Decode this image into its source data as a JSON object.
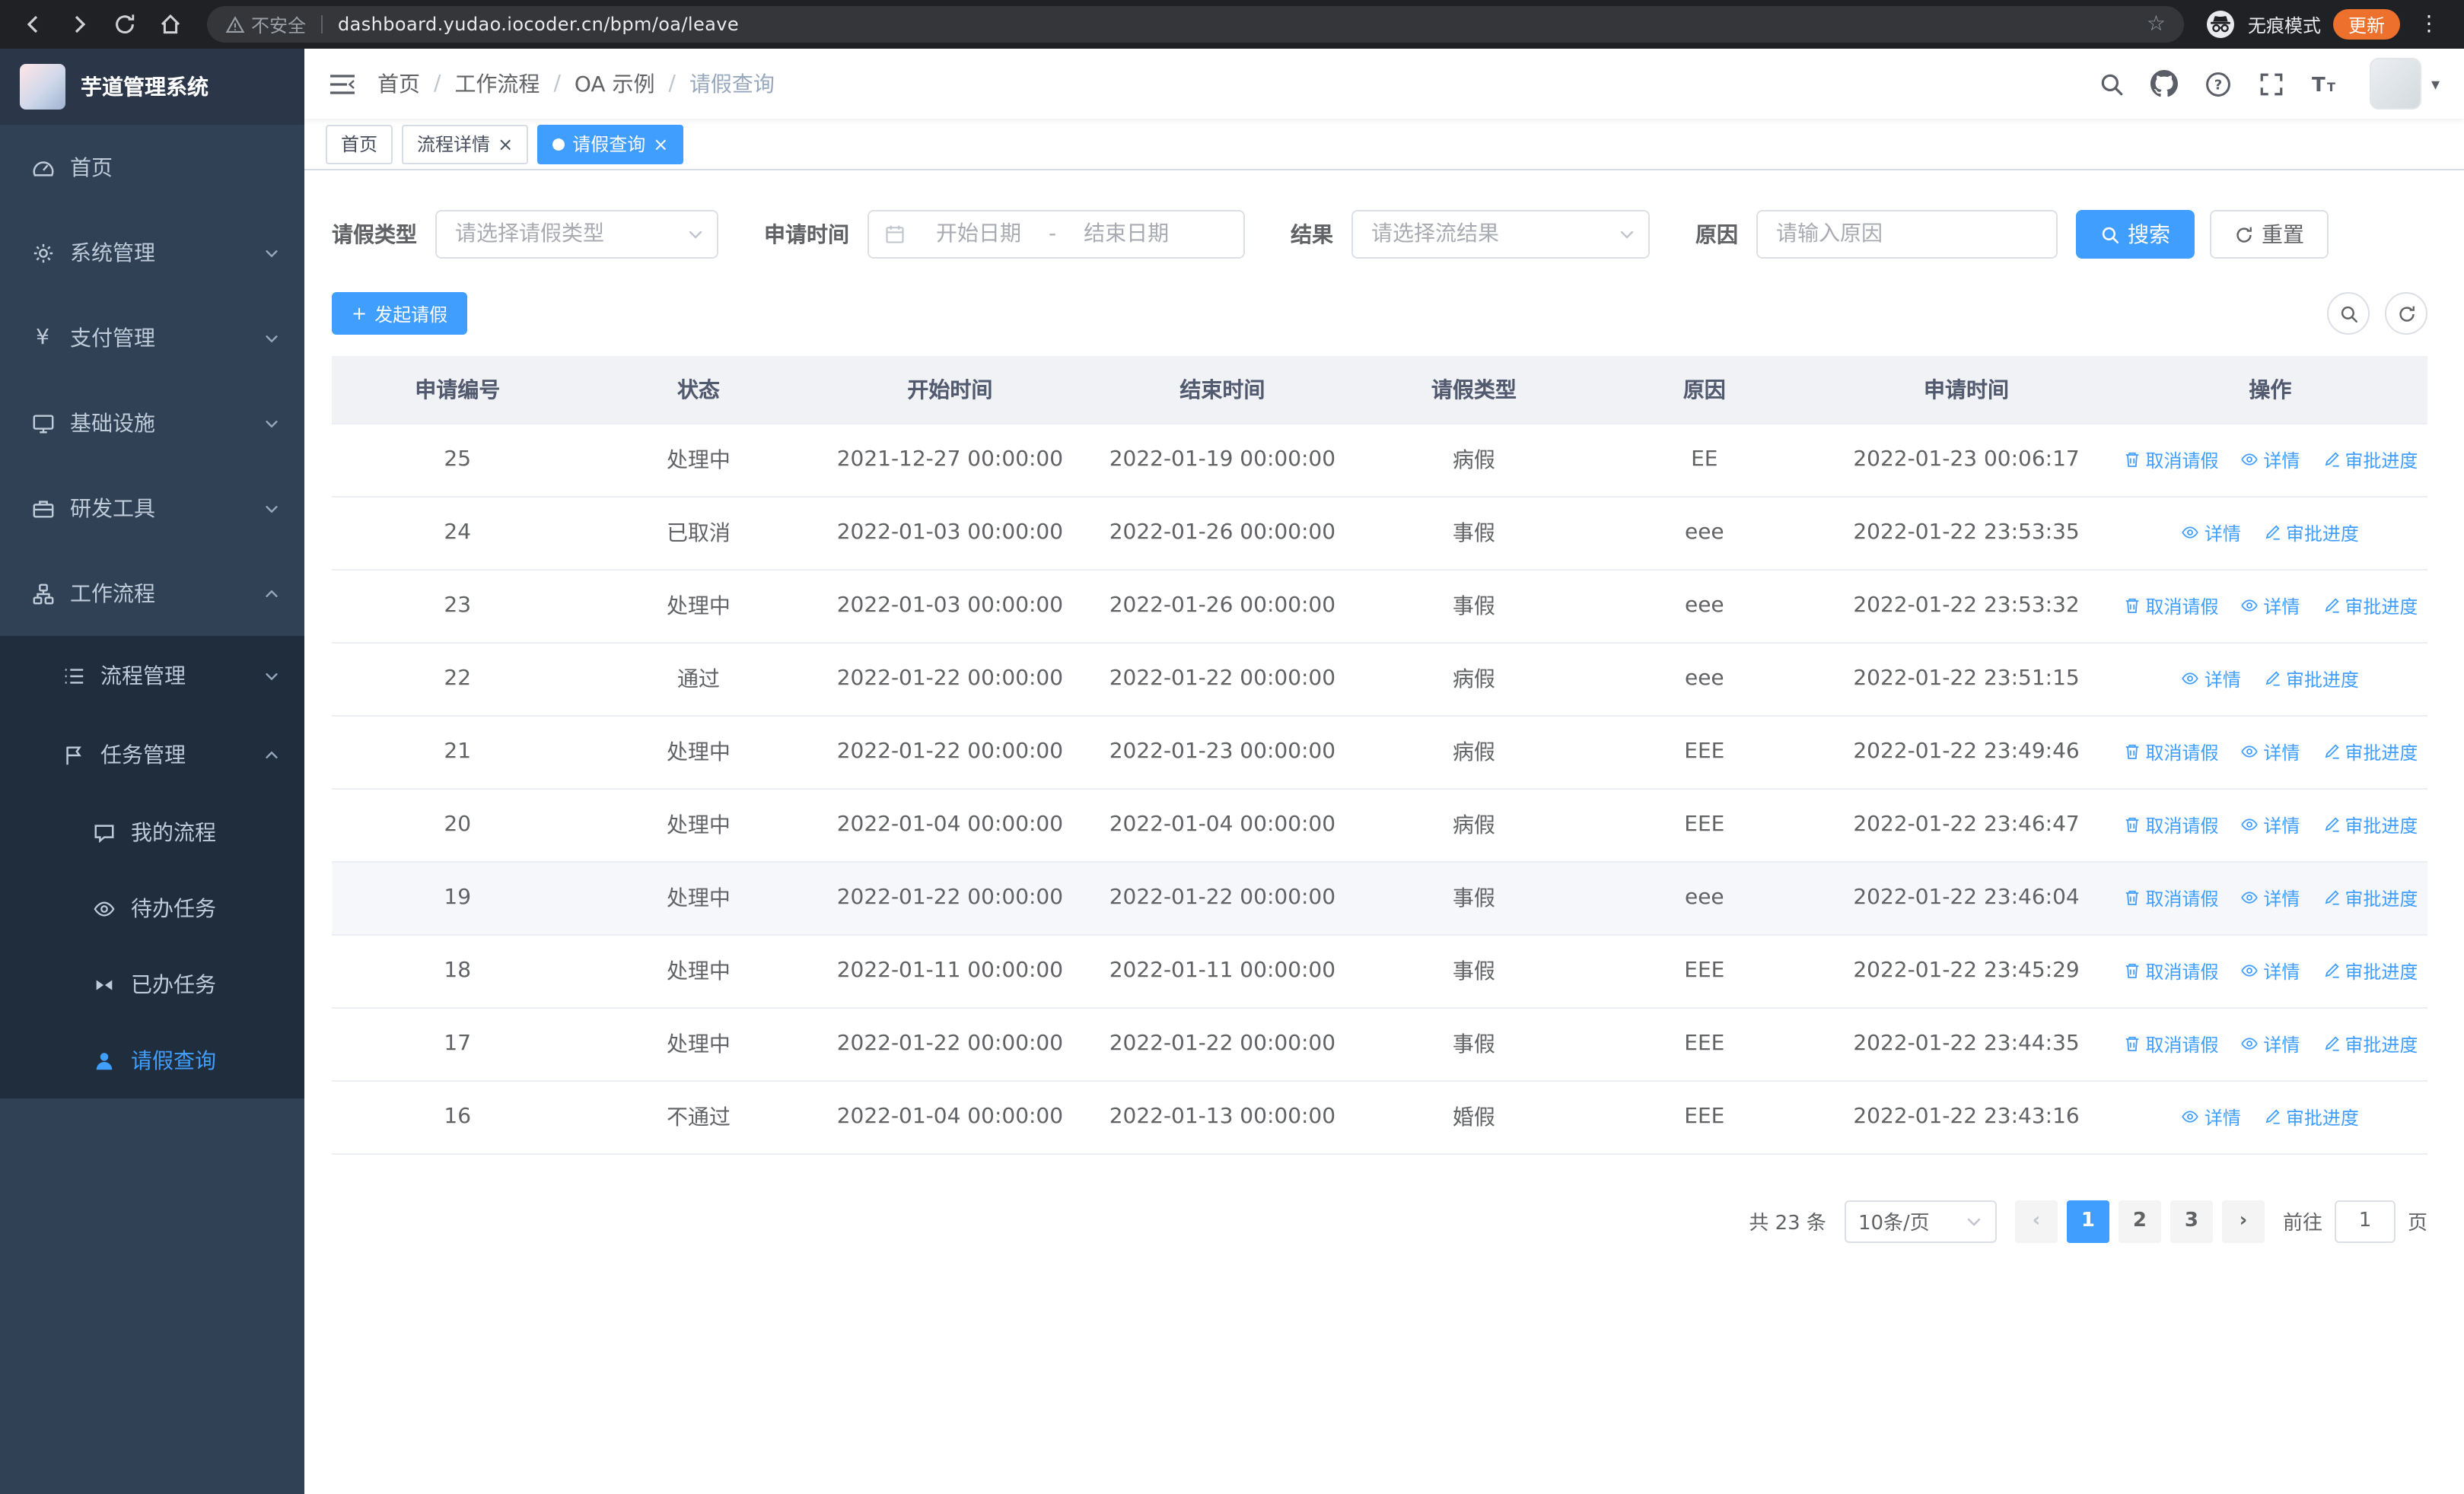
{
  "browser": {
    "security_warning": "不安全",
    "url": "dashboard.yudao.iocoder.cn/bpm/oa/leave",
    "incognito_label": "无痕模式",
    "update_label": "更新"
  },
  "icons": {
    "star": "☆",
    "kebab": "⋮",
    "close": "×",
    "plus": "+",
    "caret_down": "▾",
    "prev": "‹",
    "next": "›",
    "money": "¥"
  },
  "sidebar": {
    "logo_title": "芋道管理系统",
    "menu": [
      {
        "label": "首页"
      },
      {
        "label": "系统管理",
        "expandable": true
      },
      {
        "label": "支付管理",
        "expandable": true
      },
      {
        "label": "基础设施",
        "expandable": true
      },
      {
        "label": "研发工具",
        "expandable": true
      },
      {
        "label": "工作流程",
        "expandable": true,
        "expanded": true
      }
    ],
    "process_submenu": [
      {
        "label": "流程管理",
        "expandable": true
      },
      {
        "label": "任务管理",
        "expandable": true,
        "expanded": true
      }
    ],
    "task_children": [
      {
        "label": "我的流程"
      },
      {
        "label": "待办任务"
      },
      {
        "label": "已办任务"
      },
      {
        "label": "请假查询",
        "active": true
      }
    ]
  },
  "header": {
    "breadcrumb": [
      "首页",
      "工作流程",
      "OA 示例",
      "请假查询"
    ],
    "separator": "/"
  },
  "tabs": [
    {
      "label": "首页",
      "closable": false,
      "active": false
    },
    {
      "label": "流程详情",
      "closable": true,
      "active": false
    },
    {
      "label": "请假查询",
      "closable": true,
      "active": true
    }
  ],
  "filters": {
    "leave_type_label": "请假类型",
    "leave_type_placeholder": "请选择请假类型",
    "apply_time_label": "申请时间",
    "start_date_placeholder": "开始日期",
    "range_separator": "-",
    "end_date_placeholder": "结束日期",
    "result_label": "结果",
    "result_placeholder": "请选择流结果",
    "reason_label": "原因",
    "reason_placeholder": "请输入原因",
    "search_label": "搜索",
    "reset_label": "重置"
  },
  "toolbar": {
    "create_label": "发起请假"
  },
  "table": {
    "columns": [
      "申请编号",
      "状态",
      "开始时间",
      "结束时间",
      "请假类型",
      "原因",
      "申请时间",
      "操作"
    ],
    "actions": {
      "cancel": "取消请假",
      "detail": "详情",
      "progress": "审批进度"
    },
    "rows": [
      {
        "no": "25",
        "status": "处理中",
        "start": "2021-12-27 00:00:00",
        "end": "2022-01-19 00:00:00",
        "type": "病假",
        "reason": "EE",
        "applied": "2022-01-23 00:06:17",
        "can_cancel": true,
        "highlight": false
      },
      {
        "no": "24",
        "status": "已取消",
        "start": "2022-01-03 00:00:00",
        "end": "2022-01-26 00:00:00",
        "type": "事假",
        "reason": "eee",
        "applied": "2022-01-22 23:53:35",
        "can_cancel": false,
        "highlight": false
      },
      {
        "no": "23",
        "status": "处理中",
        "start": "2022-01-03 00:00:00",
        "end": "2022-01-26 00:00:00",
        "type": "事假",
        "reason": "eee",
        "applied": "2022-01-22 23:53:32",
        "can_cancel": true,
        "highlight": false
      },
      {
        "no": "22",
        "status": "通过",
        "start": "2022-01-22 00:00:00",
        "end": "2022-01-22 00:00:00",
        "type": "病假",
        "reason": "eee",
        "applied": "2022-01-22 23:51:15",
        "can_cancel": false,
        "highlight": false
      },
      {
        "no": "21",
        "status": "处理中",
        "start": "2022-01-22 00:00:00",
        "end": "2022-01-23 00:00:00",
        "type": "病假",
        "reason": "EEE",
        "applied": "2022-01-22 23:49:46",
        "can_cancel": true,
        "highlight": false
      },
      {
        "no": "20",
        "status": "处理中",
        "start": "2022-01-04 00:00:00",
        "end": "2022-01-04 00:00:00",
        "type": "病假",
        "reason": "EEE",
        "applied": "2022-01-22 23:46:47",
        "can_cancel": true,
        "highlight": false
      },
      {
        "no": "19",
        "status": "处理中",
        "start": "2022-01-22 00:00:00",
        "end": "2022-01-22 00:00:00",
        "type": "事假",
        "reason": "eee",
        "applied": "2022-01-22 23:46:04",
        "can_cancel": true,
        "highlight": true
      },
      {
        "no": "18",
        "status": "处理中",
        "start": "2022-01-11 00:00:00",
        "end": "2022-01-11 00:00:00",
        "type": "事假",
        "reason": "EEE",
        "applied": "2022-01-22 23:45:29",
        "can_cancel": true,
        "highlight": false
      },
      {
        "no": "17",
        "status": "处理中",
        "start": "2022-01-22 00:00:00",
        "end": "2022-01-22 00:00:00",
        "type": "事假",
        "reason": "EEE",
        "applied": "2022-01-22 23:44:35",
        "can_cancel": true,
        "highlight": false
      },
      {
        "no": "16",
        "status": "不通过",
        "start": "2022-01-04 00:00:00",
        "end": "2022-01-13 00:00:00",
        "type": "婚假",
        "reason": "EEE",
        "applied": "2022-01-22 23:43:16",
        "can_cancel": false,
        "highlight": false
      }
    ]
  },
  "pagination": {
    "total_text": "共 23 条",
    "page_size": "10条/页",
    "pages": [
      "1",
      "2",
      "3"
    ],
    "active_page": "1",
    "goto_label": "前往",
    "goto_value": "1",
    "page_unit": "页"
  }
}
